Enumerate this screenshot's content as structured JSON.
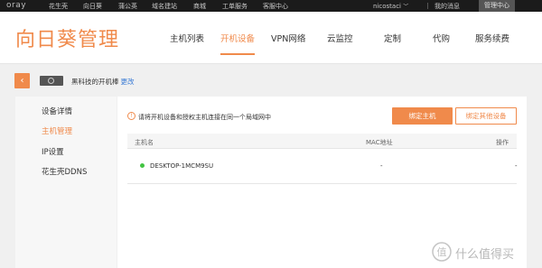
{
  "topbar": {
    "logo": "oray",
    "links": [
      "花生壳",
      "向日葵",
      "蒲公英",
      "域名建站",
      "商城",
      "工单服务",
      "客服中心"
    ],
    "user": "nicostaci",
    "user_caret": "﹀",
    "messages": "我的消息",
    "console": "管理中心"
  },
  "header": {
    "brand": "向日葵管理",
    "nav": [
      "主机列表",
      "开机设备",
      "VPN网络",
      "云监控",
      "定制",
      "代购",
      "服务续费"
    ],
    "active_nav": "开机设备"
  },
  "crumb": {
    "back_icon": "‹",
    "device_name": "黑科技的开机棒",
    "rename_link": "更改"
  },
  "sidebar": {
    "items": [
      "设备详情",
      "主机管理",
      "IP设置",
      "花生壳DDNS"
    ],
    "active_item": "主机管理"
  },
  "main": {
    "notice_icon": "!",
    "notice": "请将开机设备和授权主机连接在同一个局域网中",
    "bind_host_button": "绑定主机",
    "bind_other_button": "绑定其他设备",
    "table": {
      "columns": [
        "主机名",
        "MAC地址",
        "操作"
      ],
      "rows": [
        {
          "host": "DESKTOP-1MCM9SU",
          "mac": "-",
          "action": "-",
          "status": "online"
        }
      ]
    }
  },
  "watermark": {
    "text": "什么值得买"
  },
  "colors": {
    "accent": "#f08a4b",
    "topbar": "#1b1b1b",
    "online": "#43c443",
    "link": "#3a7bd5"
  }
}
